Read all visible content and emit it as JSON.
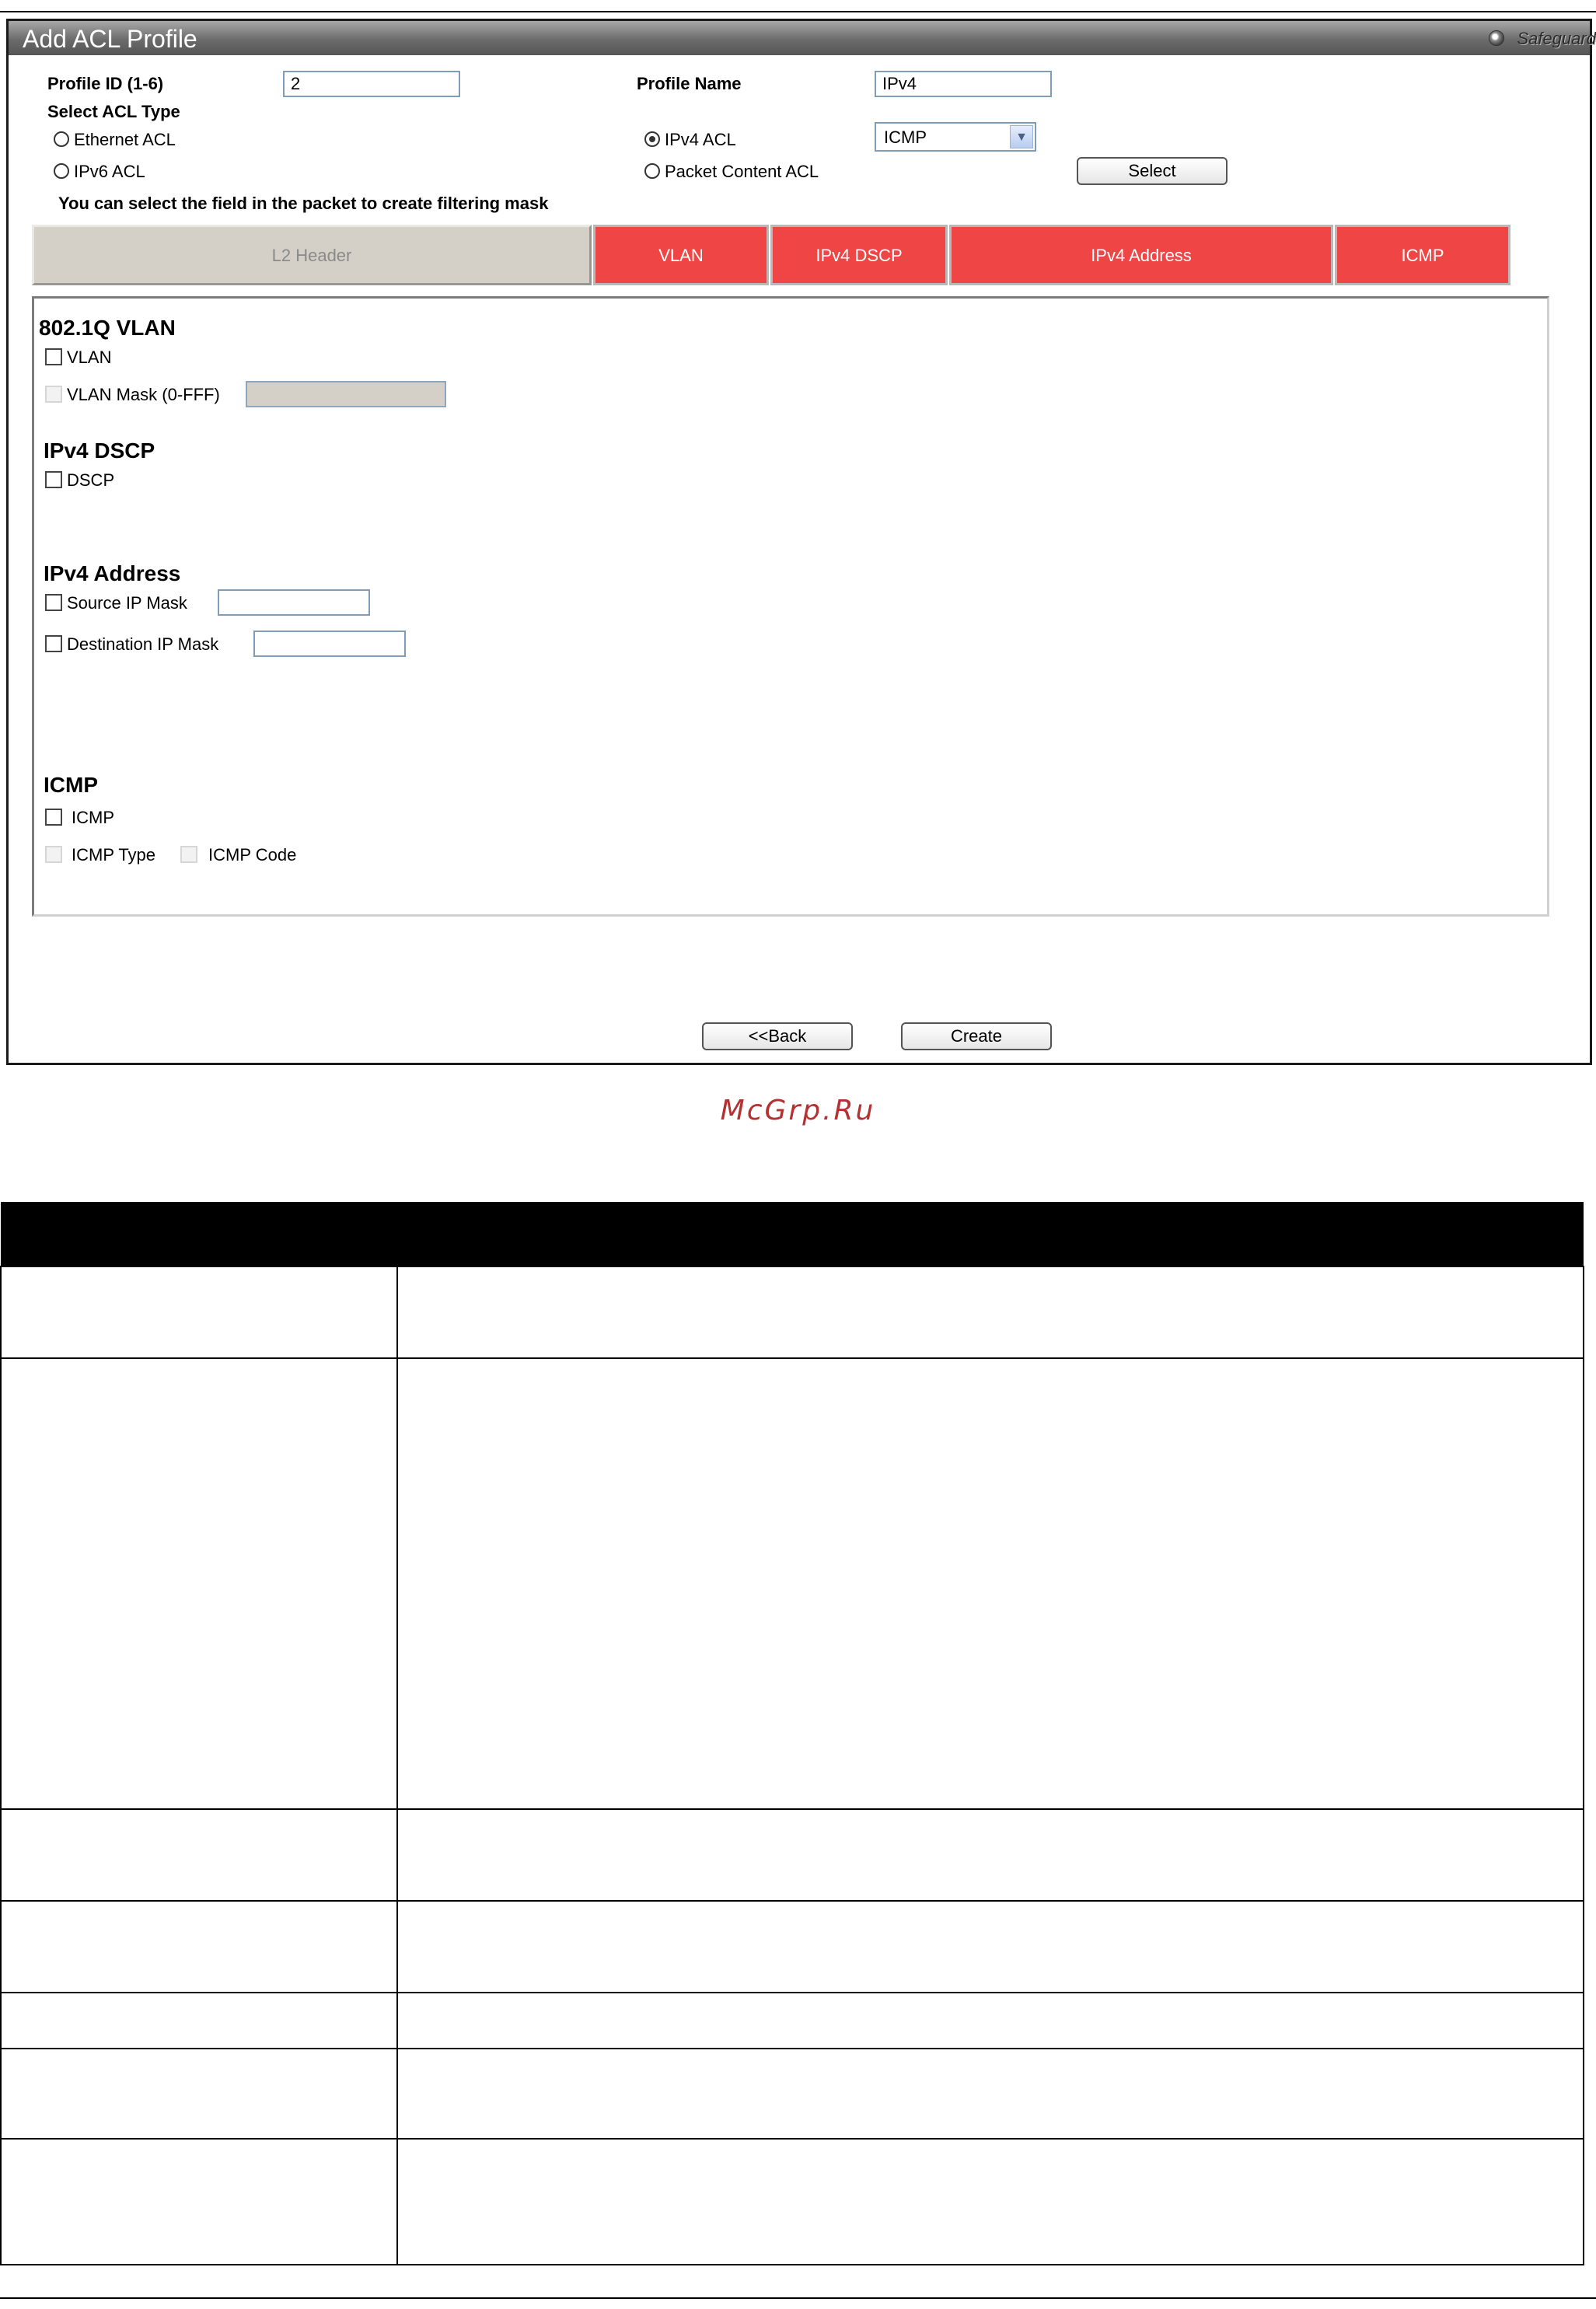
{
  "panel": {
    "title": "Add ACL Profile",
    "safeguard_label": "Safeguard",
    "profile_id": {
      "label": "Profile ID (1-6)",
      "value": "2"
    },
    "profile_name": {
      "label": "Profile Name",
      "value": "IPv4"
    },
    "select_acl_type_label": "Select ACL Type",
    "acl_types": [
      {
        "label": "Ethernet ACL",
        "checked": false
      },
      {
        "label": "IPv6 ACL",
        "checked": false
      },
      {
        "label": "IPv4 ACL",
        "checked": true
      },
      {
        "label": "Packet Content ACL",
        "checked": false
      }
    ],
    "protocol_select": {
      "value": "ICMP"
    },
    "select_button": "Select",
    "field_hint": "You can select the field in the packet to create filtering mask",
    "tabs": [
      {
        "label": "L2 Header",
        "active": false
      },
      {
        "label": "VLAN",
        "active": true
      },
      {
        "label": "IPv4 DSCP",
        "active": true
      },
      {
        "label": "IPv4 Address",
        "active": true
      },
      {
        "label": "ICMP",
        "active": true
      }
    ],
    "vlan": {
      "title": "802.1Q VLAN",
      "vlan_label": "VLAN",
      "mask_label": "VLAN Mask (0-FFF)"
    },
    "dscp": {
      "title": "IPv4 DSCP",
      "dscp_label": "DSCP"
    },
    "ipv4": {
      "title": "IPv4 Address",
      "source_label": "Source IP Mask",
      "dest_label": "Destination IP Mask"
    },
    "icmp": {
      "title": "ICMP",
      "icmp_label": "ICMP",
      "type_label": "ICMP Type",
      "code_label": "ICMP Code"
    },
    "back_button": "<<Back",
    "create_button": "Create"
  },
  "watermark": "McGrp.Ru",
  "colors": {
    "active_tab": "#f04545",
    "inactive_tab": "#d4d0c8",
    "watermark": "#b53030"
  }
}
